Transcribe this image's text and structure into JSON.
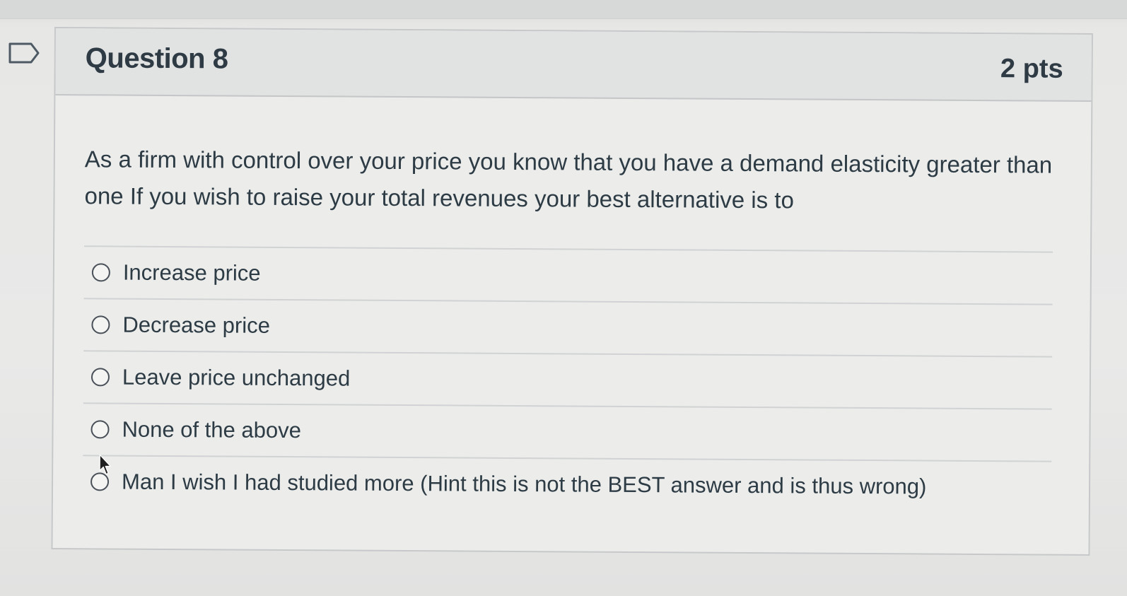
{
  "question": {
    "title": "Question 8",
    "points": "2 pts",
    "text": "As a firm with control over your price you know that you have a demand elasticity greater than one If you wish to raise your total revenues your best alternative is to",
    "answers": [
      {
        "label": "Increase price"
      },
      {
        "label": "Decrease price"
      },
      {
        "label": "Leave price unchanged"
      },
      {
        "label": "None of the above"
      },
      {
        "label": "Man I wish I had studied more (Hint this is not the BEST answer and is thus wrong)"
      }
    ],
    "selected": null
  },
  "icons": {
    "flag": "flag-outline-icon",
    "cursor": "mouse-pointer-icon",
    "radio": "radio-unchecked-icon"
  },
  "colors": {
    "text": "#2d3b45",
    "header_bg": "#e1e2e2",
    "card_bg": "#ececeb",
    "border": "#c6c8c9"
  }
}
